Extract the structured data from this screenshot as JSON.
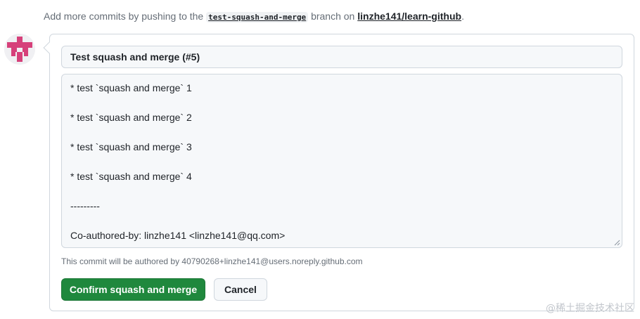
{
  "hint": {
    "prefix": "Add more commits by pushing to the ",
    "branch": "test-squash-and-merge",
    "middle": " branch on ",
    "repo": "linzhe141/learn-github",
    "suffix": "."
  },
  "commit": {
    "title": "Test squash and merge (#5)",
    "message_lines": [
      "* test `squash and merge` 1",
      "",
      "* test `squash and merge` 2",
      "",
      "* test `squash and merge` 3",
      "",
      "* test `squash and merge` 4",
      "",
      "---------",
      "",
      "Co-authored-by: linzhe141 <linzhe141@qq.com>"
    ]
  },
  "author_note": "This commit will be authored by 40790268+linzhe141@users.noreply.github.com",
  "buttons": {
    "confirm": "Confirm squash and merge",
    "cancel": "Cancel"
  },
  "watermark": "@稀土掘金技术社区",
  "colors": {
    "confirm_bg": "#1f883d",
    "avatar": "#d6407a"
  },
  "icons": {
    "avatar": "identicon-avatar",
    "resize": "resize-grip-icon"
  }
}
